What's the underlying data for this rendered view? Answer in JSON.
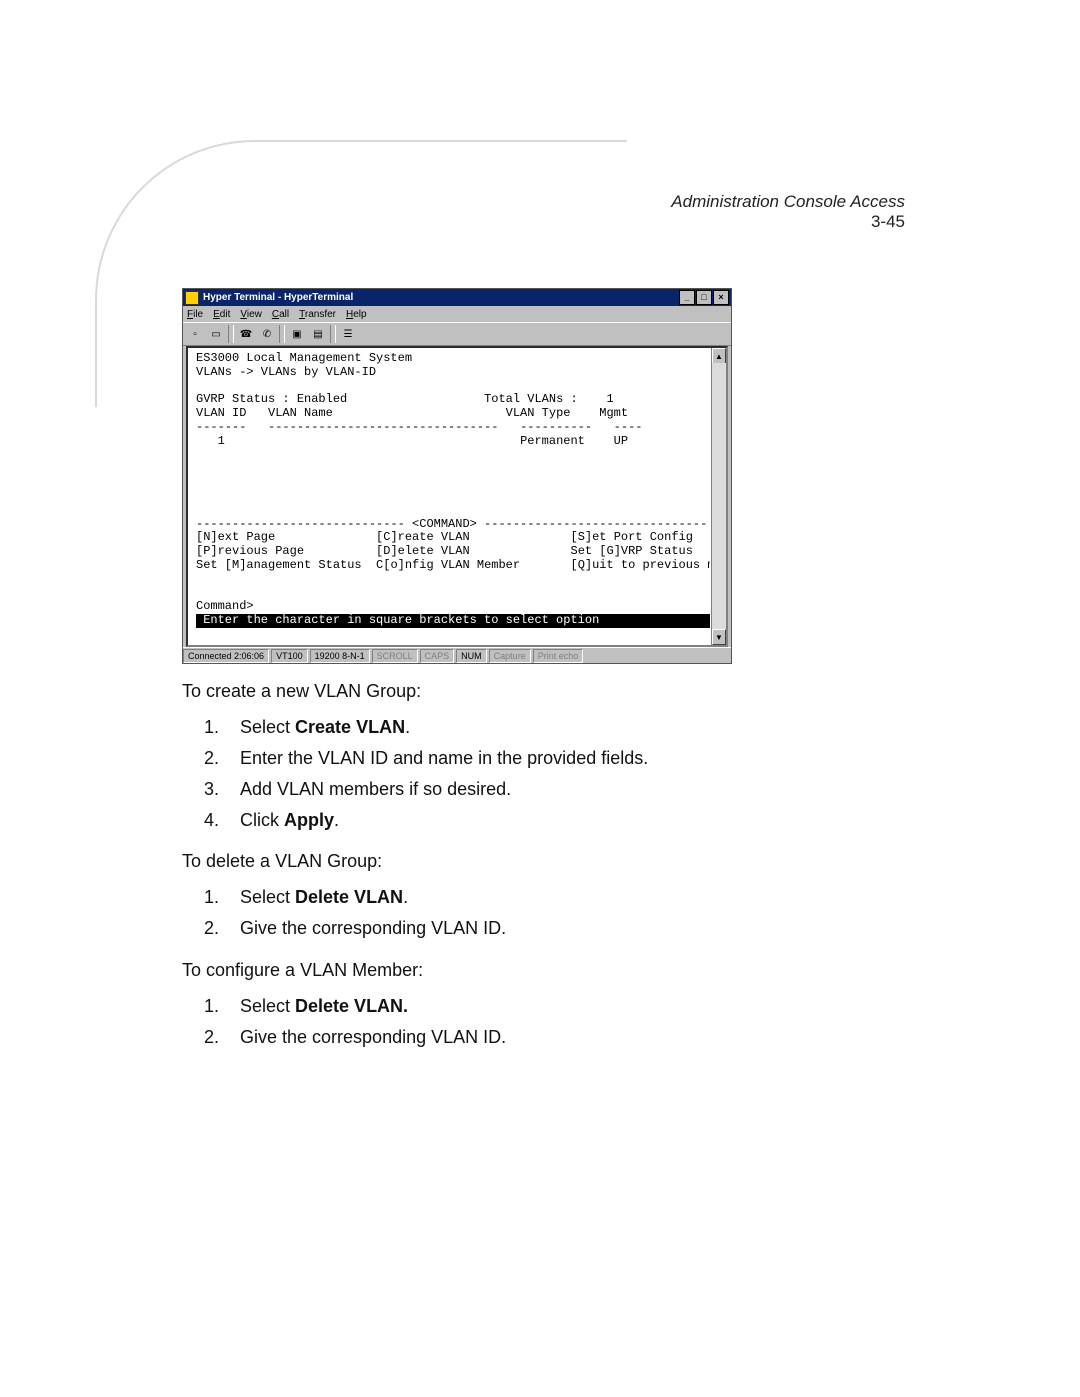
{
  "header": {
    "section": "Administration Console Access",
    "page": "3-45"
  },
  "screenshot": {
    "title": "Hyper Terminal - HyperTerminal",
    "menus": [
      "File",
      "Edit",
      "View",
      "Call",
      "Transfer",
      "Help"
    ],
    "toolbar_icons": [
      "new-icon",
      "open-icon",
      "connect-icon",
      "disconnect-icon",
      "send-icon",
      "receive-icon",
      "properties-icon"
    ],
    "window_buttons": [
      "min",
      "max",
      "close"
    ],
    "terminal": {
      "line1": "ES3000 Local Management System",
      "line2": "VLANs -> VLANs by VLAN-ID",
      "gvrp": "GVRP Status : Enabled",
      "total": "Total VLANs :    1",
      "hdr1": "VLAN ID   VLAN Name",
      "hdr2": "VLAN Type    Mgmt",
      "dash1": "-------   --------------------------------",
      "dash2": "----------   ----",
      "row1": "   1",
      "row2": "Permanent    UP",
      "cmdrule": "----------------------------- <COMMAND> -------------------------------",
      "c_next": "[N]ext Page",
      "c_create": "[C]reate VLAN",
      "c_setport": "[S]et Port Config",
      "c_prev": "[P]revious Page",
      "c_delete": "[D]elete VLAN",
      "c_setgvrp": "Set [G]VRP Status",
      "c_mgmt": "Set [M]anagement Status",
      "c_config": "C[o]nfig VLAN Member",
      "c_quit": "[Q]uit to previous menu",
      "prompt": "Command>",
      "hint": " Enter the character in square brackets to select option                "
    },
    "status": {
      "conn": "Connected 2:06:06",
      "emu": "VT100",
      "baud": "19200 8-N-1",
      "scroll": "SCROLL",
      "caps": "CAPS",
      "num": "NUM",
      "capture": "Capture",
      "echo": "Print echo"
    }
  },
  "body": {
    "p1": "To create a new VLAN Group:",
    "s1_1a": "Select ",
    "s1_1b": "Create VLAN",
    "s1_1c": ".",
    "s1_2": "Enter the VLAN ID and name in the provided fields.",
    "s1_3": "Add VLAN members if so desired.",
    "s1_4a": "Click ",
    "s1_4b": "Apply",
    "s1_4c": ".",
    "p2": "To delete a VLAN Group:",
    "s2_1a": "Select ",
    "s2_1b": "Delete VLAN",
    "s2_1c": ".",
    "s2_2": "Give the corresponding VLAN ID.",
    "p3": "To configure a VLAN Member:",
    "s3_1a": "Select ",
    "s3_1b": "Delete VLAN.",
    "s3_1c": "",
    "s3_2": "Give the corresponding VLAN ID."
  }
}
